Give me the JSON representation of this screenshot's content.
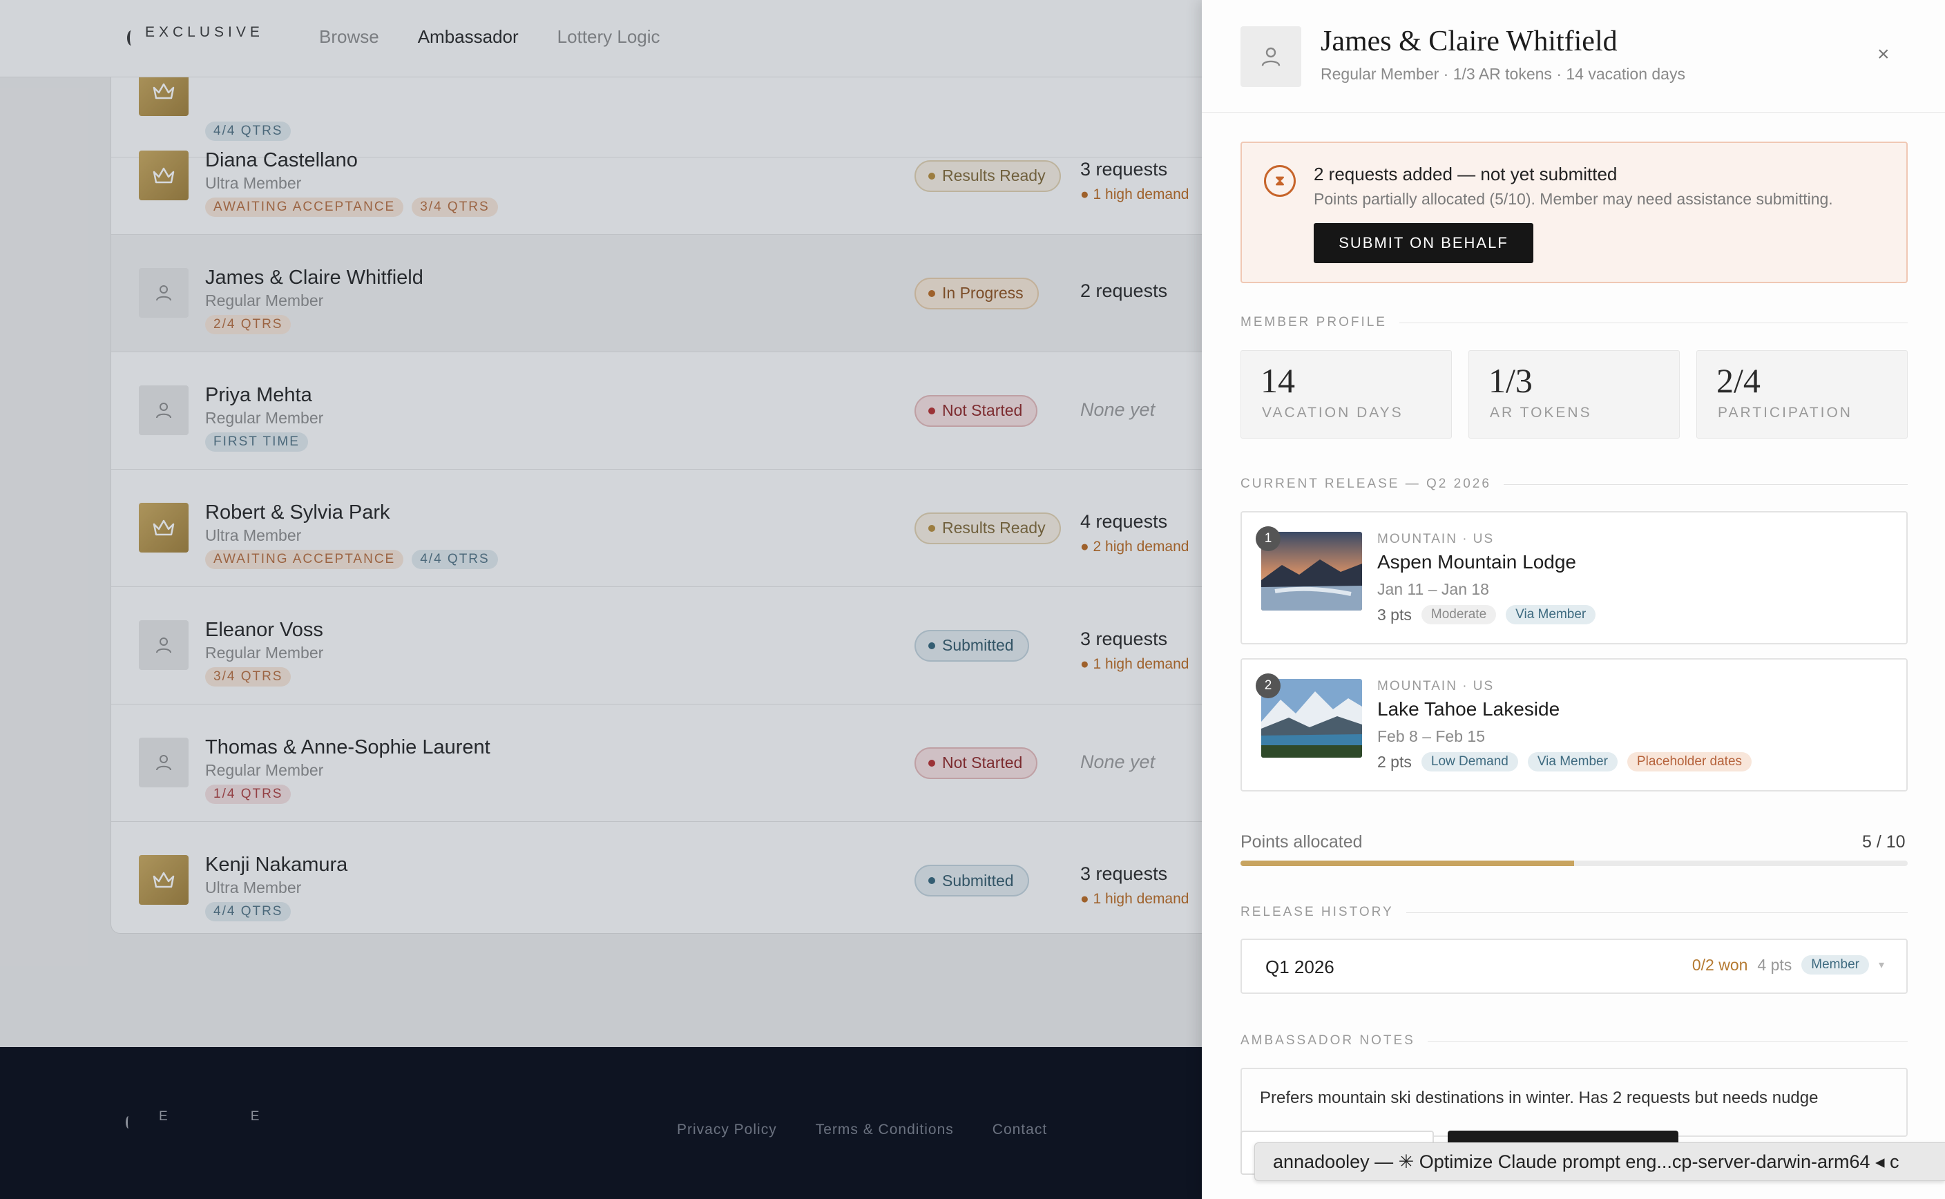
{
  "nav": {
    "brand": "EXCLUSIVE",
    "links": [
      "Browse",
      "Ambassador",
      "Lottery Logic"
    ]
  },
  "members": [
    {
      "tags": [
        "4/4 QTRS"
      ],
      "status": ""
    },
    {
      "name": "Diana Castellano",
      "type": "Ultra Member",
      "tags": [
        "AWAITING ACCEPTANCE",
        "3/4 QTRS"
      ],
      "status": "Results Ready",
      "requests": "3 requests",
      "high_demand": "1 high demand"
    },
    {
      "name": "James & Claire Whitfield",
      "type": "Regular Member",
      "tags": [
        "2/4 QTRS"
      ],
      "status": "In Progress",
      "requests": "2 requests"
    },
    {
      "name": "Priya Mehta",
      "type": "Regular Member",
      "tags": [
        "FIRST TIME"
      ],
      "status": "Not Started",
      "requests": "None yet"
    },
    {
      "name": "Robert & Sylvia Park",
      "type": "Ultra Member",
      "tags": [
        "AWAITING ACCEPTANCE",
        "4/4 QTRS"
      ],
      "status": "Results Ready",
      "requests": "4 requests",
      "high_demand": "2 high demand"
    },
    {
      "name": "Eleanor Voss",
      "type": "Regular Member",
      "tags": [
        "3/4 QTRS"
      ],
      "status": "Submitted",
      "requests": "3 requests",
      "high_demand": "1 high demand"
    },
    {
      "name": "Thomas & Anne-Sophie Laurent",
      "type": "Regular Member",
      "tags": [
        "1/4 QTRS"
      ],
      "status": "Not Started",
      "requests": "None yet"
    },
    {
      "name": "Kenji Nakamura",
      "type": "Ultra Member",
      "tags": [
        "4/4 QTRS"
      ],
      "status": "Submitted",
      "requests": "3 requests",
      "high_demand": "1 high demand"
    }
  ],
  "footer": {
    "brand_letters": [
      "E",
      "E"
    ],
    "links": [
      "Privacy Policy",
      "Terms & Conditions",
      "Contact"
    ]
  },
  "drawer": {
    "name": "James & Claire Whitfield",
    "subtitle": "Regular Member · 1/3 AR tokens · 14 vacation days",
    "close": "×",
    "alert": {
      "icon": "⧗",
      "title": "2 requests added — not yet submitted",
      "desc": "Points partially allocated (5/10). Member may need assistance submitting.",
      "button": "SUBMIT ON BEHALF"
    },
    "profile_label": "MEMBER PROFILE",
    "stats": [
      {
        "value": "14",
        "label": "VACATION DAYS"
      },
      {
        "value": "1/3",
        "label": "AR TOKENS"
      },
      {
        "value": "2/4",
        "label": "PARTICIPATION"
      }
    ],
    "release_label": "CURRENT RELEASE — Q2 2026",
    "requests": [
      {
        "rank": "1",
        "location": "MOUNTAIN · US",
        "name": "Aspen Mountain Lodge",
        "dates": "Jan 11 – Jan 18",
        "points": "3 pts",
        "chips": [
          "Moderate",
          "Via Member"
        ]
      },
      {
        "rank": "2",
        "location": "MOUNTAIN · US",
        "name": "Lake Tahoe Lakeside",
        "dates": "Feb 8 – Feb 15",
        "points": "2 pts",
        "chips": [
          "Low Demand",
          "Via Member",
          "Placeholder dates"
        ]
      }
    ],
    "points": {
      "label": "Points allocated",
      "value": "5 / 10",
      "fraction": 0.5
    },
    "history_label": "RELEASE HISTORY",
    "history": [
      {
        "quarter": "Q1 2026",
        "won": "0/2 won",
        "points": "4 pts",
        "via": "Member",
        "chevron": "▾"
      }
    ],
    "notes_label": "AMBASSADOR NOTES",
    "notes": "Prefers mountain ski destinations in winter. Has 2 requests but needs nudge"
  },
  "taskbar": "annadooley — ✳ Optimize Claude prompt eng...cp-server-darwin-arm64 ◂ c",
  "colors": {
    "accent_gold": "#c8a460",
    "alert_orange": "#c7652b",
    "footer_bg": "#0e1422"
  }
}
